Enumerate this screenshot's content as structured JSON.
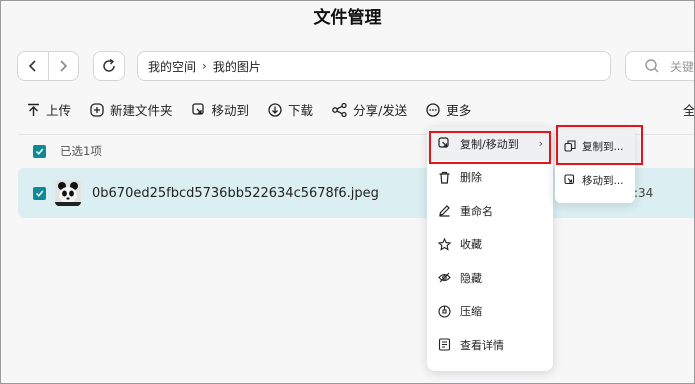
{
  "window": {
    "title": "文件管理"
  },
  "nav": {
    "back_icon": "chevron-left-icon",
    "forward_icon": "chevron-right-icon",
    "refresh_icon": "refresh-icon"
  },
  "breadcrumb": {
    "items": [
      "我的空间",
      "我的图片"
    ]
  },
  "search": {
    "placeholder": "关键"
  },
  "toolbar": {
    "upload": "上传",
    "new_folder": "新建文件夹",
    "move_to": "移动到",
    "download": "下载",
    "share": "分享/发送",
    "more": "更多",
    "select_all_partial": "全"
  },
  "list": {
    "selected_count": "已选1项",
    "files": [
      {
        "name": "0b670ed25fbcd5736bb522634c5678f6.jpeg",
        "time_partial": ":34",
        "checked": true
      }
    ]
  },
  "context_menu": {
    "items": [
      {
        "label": "复制/移动到",
        "icon": "copy-move-icon",
        "has_submenu": true
      },
      {
        "label": "删除",
        "icon": "trash-icon"
      },
      {
        "label": "重命名",
        "icon": "pencil-icon"
      },
      {
        "label": "收藏",
        "icon": "star-icon"
      },
      {
        "label": "隐藏",
        "icon": "eye-off-icon"
      },
      {
        "label": "压缩",
        "icon": "compress-icon"
      },
      {
        "label": "查看详情",
        "icon": "details-icon"
      }
    ]
  },
  "submenu": {
    "items": [
      {
        "label": "复制到...",
        "icon": "copy-icon"
      },
      {
        "label": "移动到...",
        "icon": "move-icon"
      }
    ]
  },
  "colors": {
    "accent": "#0e8a94",
    "selected_row": "#dbeff2",
    "highlight_box": "#e0161d"
  }
}
